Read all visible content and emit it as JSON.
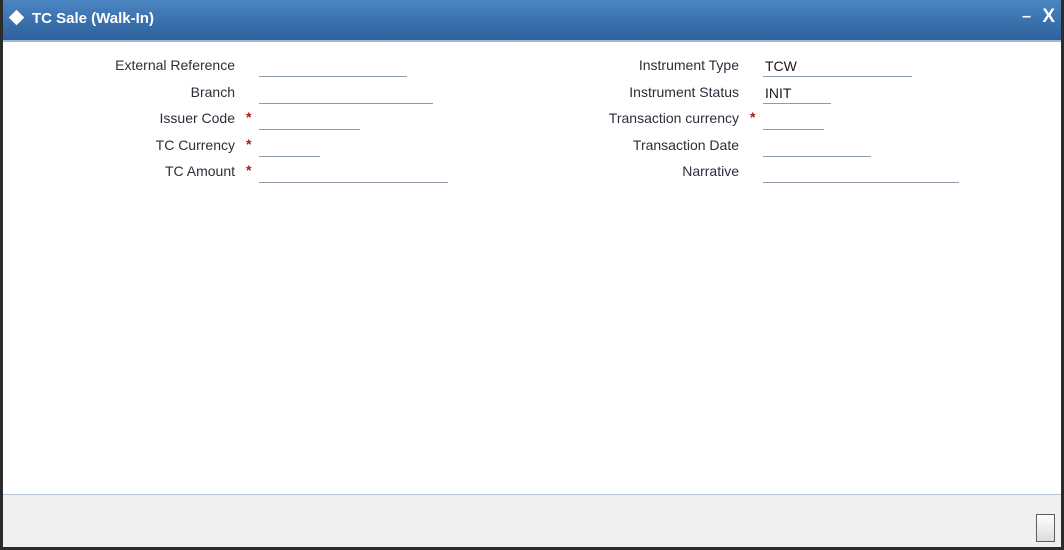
{
  "window": {
    "title": "TC Sale (Walk-In)",
    "minimize_glyph": "–",
    "close_glyph": "X"
  },
  "form": {
    "required_marker": "*",
    "left": {
      "external_reference": {
        "label": "External Reference",
        "value": ""
      },
      "branch": {
        "label": "Branch",
        "value": ""
      },
      "issuer_code": {
        "label": "Issuer Code",
        "value": ""
      },
      "tc_currency": {
        "label": "TC Currency",
        "value": ""
      },
      "tc_amount": {
        "label": "TC Amount",
        "value": ""
      }
    },
    "right": {
      "instrument_type": {
        "label": "Instrument Type",
        "value": "TCW"
      },
      "instrument_status": {
        "label": "Instrument Status",
        "value": "INIT"
      },
      "transaction_currency": {
        "label": "Transaction currency",
        "value": ""
      },
      "transaction_date": {
        "label": "Transaction Date",
        "value": ""
      },
      "narrative": {
        "label": "Narrative",
        "value": ""
      }
    }
  },
  "colors": {
    "titlebar": "#3a70ad",
    "label_text": "#2a2f3a",
    "required": "#b01717",
    "footer": "#f0f0f0"
  }
}
